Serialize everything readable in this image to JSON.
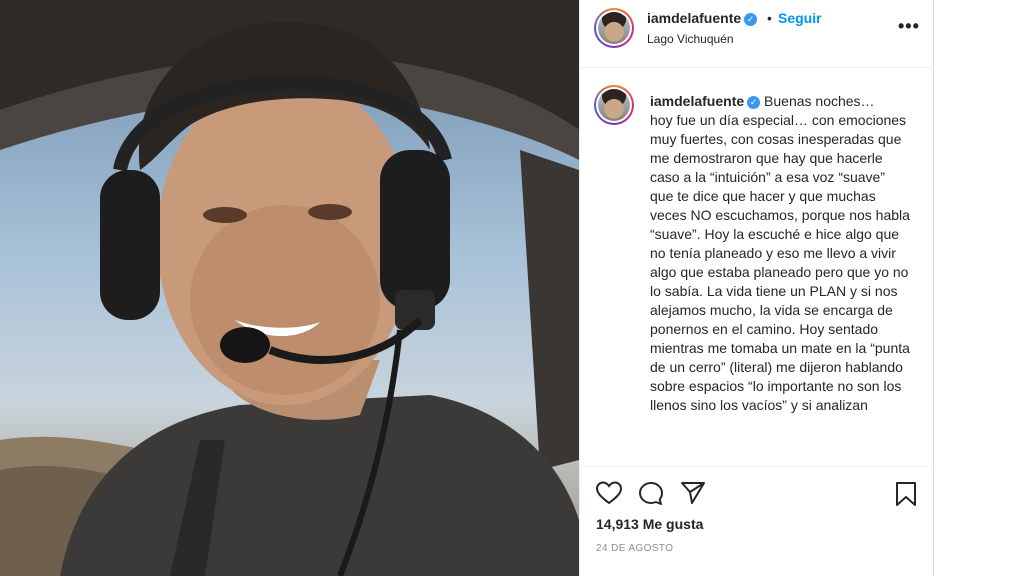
{
  "post": {
    "username": "iamdelafuente",
    "follow_label": "Seguir",
    "separator": "•",
    "location": "Lago Vichuquén",
    "more_label": "•••",
    "caption_opening": "Buenas noches…",
    "caption_body": "hoy fue un día especial… con emociones muy fuertes, con cosas inesperadas que me demostraron que hay que hacerle caso a la “intuición” a esa voz “suave”\nque te dice que hacer y que muchas veces NO escuchamos, porque nos habla “suave”. Hoy la escuché e hice algo que no tenía planeado y eso me llevo a vivir algo que estaba planeado pero que yo no lo sabía. La vida tiene un PLAN y si nos alejamos mucho, la vida se encarga de ponernos en el camino. Hoy sentado mientras me tomaba un mate en la “punta de un cerro” (literal) me dijeron hablando sobre espacios “lo importante no son los llenos sino los vacíos” y si analizan",
    "likes": "14,913 Me gusta",
    "date": "24 DE AGOSTO"
  },
  "icons": {
    "verified": "verified-badge-icon",
    "like": "heart-icon",
    "comment": "comment-bubble-icon",
    "share": "paper-plane-icon",
    "save": "bookmark-icon",
    "more": "more-options-icon"
  },
  "colors": {
    "link_blue": "#0095f6",
    "verified_blue": "#3897f0",
    "text": "#262626",
    "muted": "#8e8e8e",
    "divider": "#efefef"
  }
}
